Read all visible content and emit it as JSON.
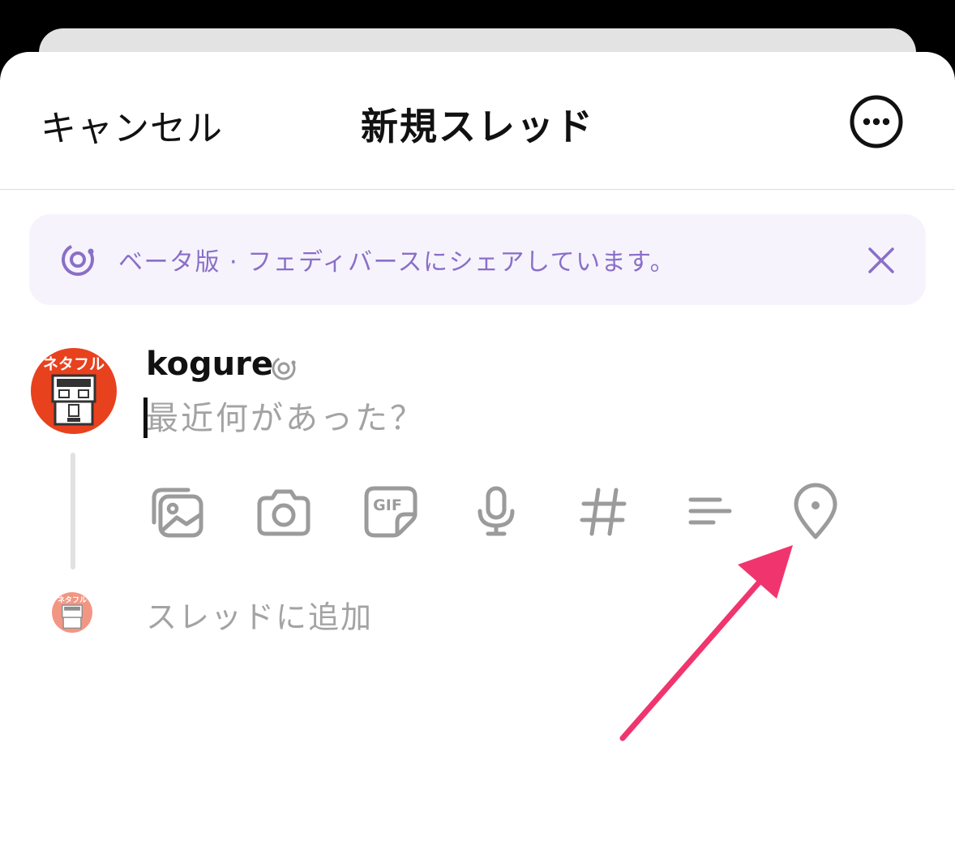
{
  "header": {
    "cancel_label": "キャンセル",
    "title": "新規スレッド",
    "more_icon": "ellipsis-circle-icon"
  },
  "banner": {
    "text": "ベータ版 · フェディバースにシェアしています。",
    "icon": "fediverse-icon",
    "close_icon": "close-icon"
  },
  "post": {
    "username": "kogure",
    "avatar_text": "ネタフル",
    "compose_placeholder": "最近何があった？",
    "tools": [
      {
        "name": "gallery-icon"
      },
      {
        "name": "camera-icon"
      },
      {
        "name": "gif-icon",
        "label": "GIF"
      },
      {
        "name": "microphone-icon"
      },
      {
        "name": "hashtag-icon"
      },
      {
        "name": "poll-icon"
      },
      {
        "name": "location-pin-icon"
      }
    ],
    "add_thread_label": "スレッドに追加"
  },
  "colors": {
    "accent_purple": "#8a6fc7",
    "banner_bg": "#f6f3fd",
    "avatar_red": "#e8411e",
    "arrow_pink": "#f0356e",
    "icon_gray": "#9b9b9b"
  }
}
